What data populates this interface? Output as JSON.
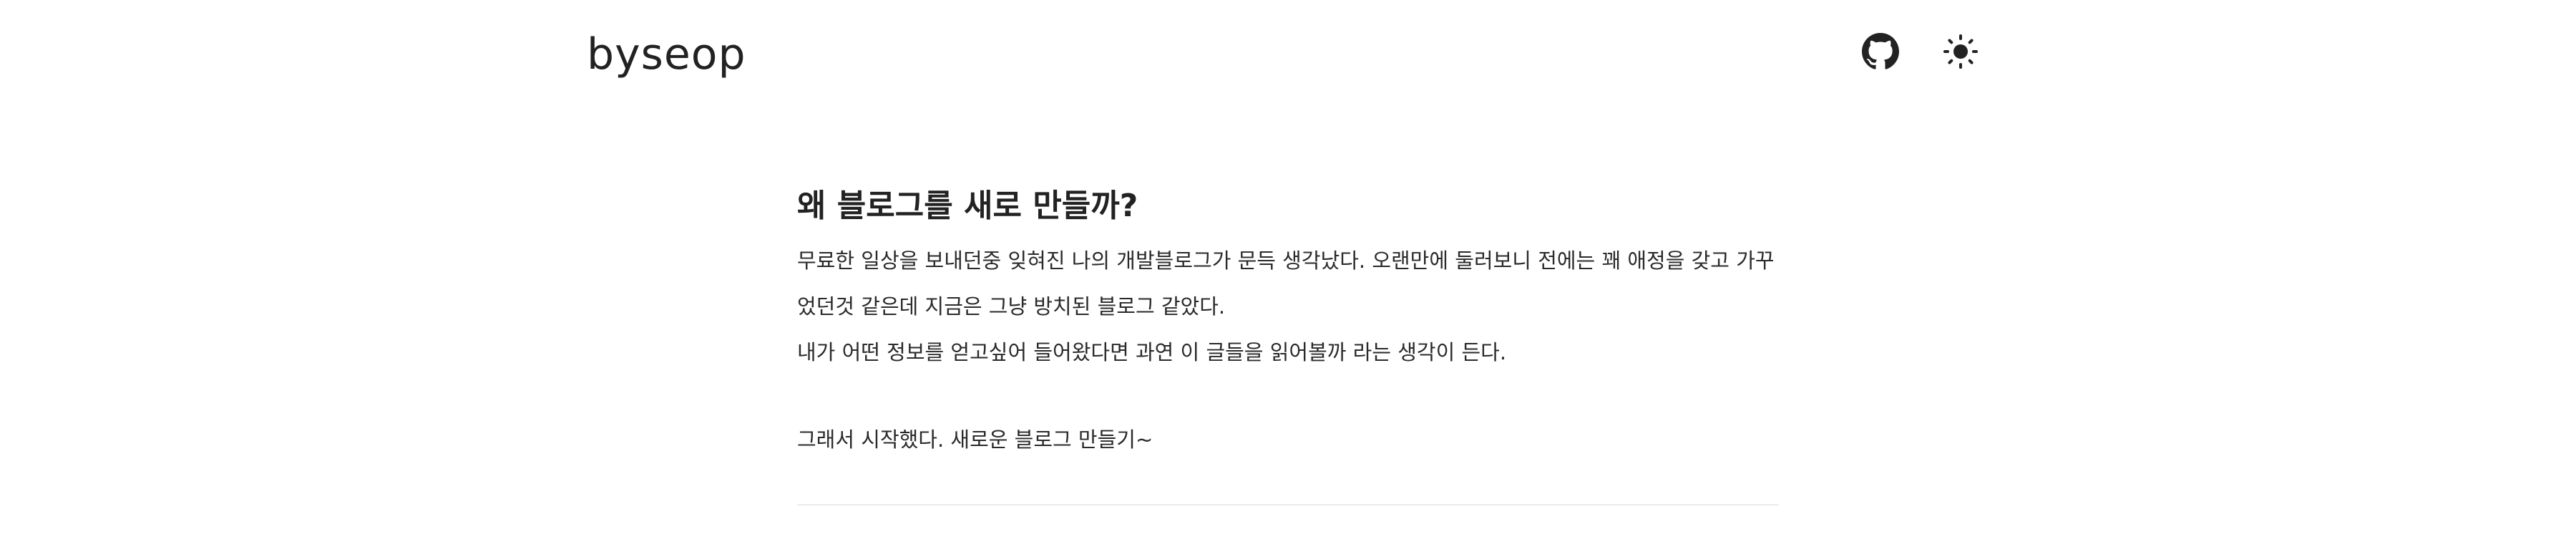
{
  "header": {
    "logo": "byseop",
    "github_icon": "github-icon",
    "theme_icon": "sun-icon"
  },
  "post": {
    "title": "왜 블로그를 새로 만들까?",
    "paragraphs": [
      "무료한 일상을 보내던중 잊혀진 나의 개발블로그가 문득 생각났다. 오랜만에 둘러보니 전에는 꽤 애정을 갖고 가꾸었던것 같은데 지금은 그냥 방치된 블로그 같았다.",
      "내가 어떤 정보를 얻고싶어 들어왔다면 과연 이 글들을 읽어볼까 라는 생각이 든다.",
      "그래서 시작했다. 새로운 블로그 만들기~"
    ]
  },
  "colors": {
    "text": "#222222",
    "background": "#ffffff",
    "divider": "#ececec"
  }
}
